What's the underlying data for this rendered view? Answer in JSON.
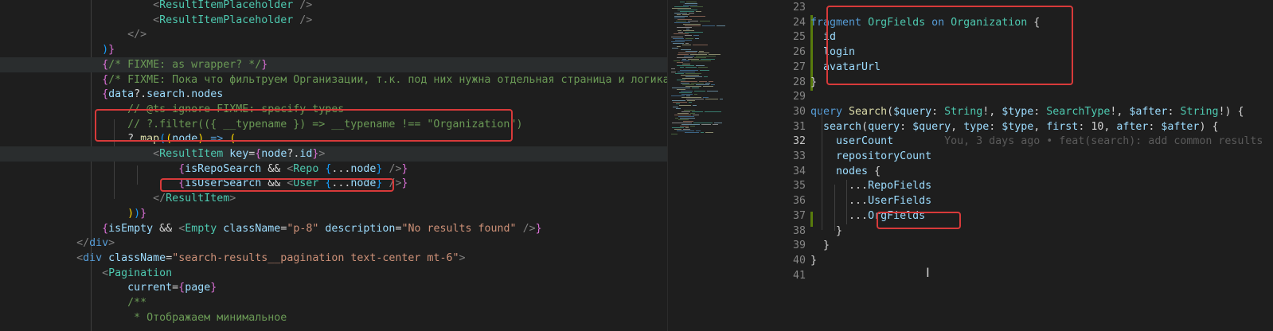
{
  "left_editor": {
    "lines": [
      [
        [
          "",
          "pun",
          "                        "
        ],
        [
          "<",
          "tag"
        ],
        [
          "ResultItemPlaceholder",
          "ty"
        ],
        [
          " />",
          "tag"
        ]
      ],
      [
        [
          "",
          "pun",
          "                        "
        ],
        [
          "<",
          "tag"
        ],
        [
          "ResultItemPlaceholder",
          "ty"
        ],
        [
          " />",
          "tag"
        ]
      ],
      [
        [
          "",
          "pun",
          "                    "
        ],
        [
          "</>",
          "tag"
        ]
      ],
      [
        [
          "",
          "pun",
          "                "
        ],
        [
          ")",
          "br3"
        ],
        [
          "}",
          "br2"
        ]
      ],
      [
        [
          "",
          "pun",
          "                "
        ],
        [
          "{",
          "br2"
        ],
        [
          "/* FIXME: as wrapper? */",
          "cm"
        ],
        [
          "}",
          "br2"
        ]
      ],
      [
        [
          "",
          "pun",
          "                "
        ],
        [
          "{",
          "br2"
        ],
        [
          "/* FIXME: Пока что фильтруем Организации, т.к. под них нужна отдельная страница и логика */",
          "cm"
        ],
        [
          "}",
          "br2"
        ]
      ],
      [
        [
          "",
          "pun",
          "                "
        ],
        [
          "{",
          "br2"
        ],
        [
          "data",
          "var"
        ],
        [
          "?.",
          "pun"
        ],
        [
          "search",
          "var"
        ],
        [
          ".",
          "pun"
        ],
        [
          "nodes",
          "var"
        ]
      ],
      [
        [
          "",
          "pun",
          "                    "
        ],
        [
          "// @ts-ignore FIXME: specify types",
          "cm"
        ]
      ],
      [
        [
          "",
          "pun",
          "                    "
        ],
        [
          "// ?.filter(({ __typename }) => __typename !== \"Organization\")",
          "cm"
        ]
      ],
      [
        [
          "",
          "pun",
          "                    "
        ],
        [
          "?.",
          "pun"
        ],
        [
          "map",
          "fn"
        ],
        [
          "(",
          "br3"
        ],
        [
          "(",
          "br1"
        ],
        [
          "node",
          "var"
        ],
        [
          ")",
          "br1"
        ],
        [
          " => ",
          "kw"
        ],
        [
          "(",
          "br1"
        ]
      ],
      [
        [
          "",
          "pun",
          "                        "
        ],
        [
          "<",
          "tag"
        ],
        [
          "ResultItem",
          "ty"
        ],
        [
          " ",
          "pun"
        ],
        [
          "key",
          "var"
        ],
        [
          "=",
          "pun"
        ],
        [
          "{",
          "br2"
        ],
        [
          "node",
          "var"
        ],
        [
          "?.",
          "pun"
        ],
        [
          "id",
          "var"
        ],
        [
          "}",
          "br2"
        ],
        [
          ">",
          "tag"
        ]
      ],
      [
        [
          "",
          "pun",
          "                            "
        ],
        [
          "{",
          "br2"
        ],
        [
          "isRepoSearch",
          "var"
        ],
        [
          " && ",
          "pun"
        ],
        [
          "<",
          "tag"
        ],
        [
          "Repo",
          "ty"
        ],
        [
          " ",
          "pun"
        ],
        [
          "{",
          "br3"
        ],
        [
          "...",
          "pun"
        ],
        [
          "node",
          "var"
        ],
        [
          "}",
          "br3"
        ],
        [
          " />",
          "tag"
        ],
        [
          "}",
          "br2"
        ]
      ],
      [
        [
          "",
          "pun",
          "                            "
        ],
        [
          "{",
          "br2"
        ],
        [
          "isUserSearch",
          "var"
        ],
        [
          " && ",
          "pun"
        ],
        [
          "<",
          "tag"
        ],
        [
          "User",
          "ty"
        ],
        [
          " ",
          "pun"
        ],
        [
          "{",
          "br3"
        ],
        [
          "...",
          "pun"
        ],
        [
          "node",
          "var"
        ],
        [
          "}",
          "br3"
        ],
        [
          " />",
          "tag"
        ],
        [
          "}",
          "br2"
        ]
      ],
      [
        [
          "",
          "pun",
          "                        "
        ],
        [
          "</",
          "tag"
        ],
        [
          "ResultItem",
          "ty"
        ],
        [
          ">",
          "tag"
        ]
      ],
      [
        [
          "",
          "pun",
          "                    "
        ],
        [
          ")",
          "br1"
        ],
        [
          ")",
          "br3"
        ],
        [
          "}",
          "br2"
        ]
      ],
      [
        [
          "",
          "pun",
          "                "
        ],
        [
          "{",
          "br2"
        ],
        [
          "isEmpty",
          "var"
        ],
        [
          " && ",
          "pun"
        ],
        [
          "<",
          "tag"
        ],
        [
          "Empty",
          "ty"
        ],
        [
          " ",
          "pun"
        ],
        [
          "className",
          "var"
        ],
        [
          "=",
          "pun"
        ],
        [
          "\"p-8\"",
          "str"
        ],
        [
          " ",
          "pun"
        ],
        [
          "description",
          "var"
        ],
        [
          "=",
          "pun"
        ],
        [
          "\"No results found\"",
          "str"
        ],
        [
          " />",
          "tag"
        ],
        [
          "}",
          "br2"
        ]
      ],
      [
        [
          "",
          "pun",
          "            "
        ],
        [
          "</",
          "tag"
        ],
        [
          "div",
          "kw"
        ],
        [
          ">",
          "tag"
        ]
      ],
      [
        [
          "",
          "pun",
          "            "
        ],
        [
          "<",
          "tag"
        ],
        [
          "div",
          "kw"
        ],
        [
          " ",
          "pun"
        ],
        [
          "className",
          "var"
        ],
        [
          "=",
          "pun"
        ],
        [
          "\"search-results__pagination text-center mt-6\"",
          "str"
        ],
        [
          ">",
          "tag"
        ]
      ],
      [
        [
          "",
          "pun",
          "                "
        ],
        [
          "<",
          "tag"
        ],
        [
          "Pagination",
          "ty"
        ]
      ],
      [
        [
          "",
          "pun",
          "                    "
        ],
        [
          "current",
          "var"
        ],
        [
          "=",
          "pun"
        ],
        [
          "{",
          "br2"
        ],
        [
          "page",
          "var"
        ],
        [
          "}",
          "br2"
        ]
      ],
      [
        [
          "",
          "pun",
          "                    "
        ],
        [
          "/**",
          "cm"
        ]
      ],
      [
        [
          "",
          "pun",
          "                     "
        ],
        [
          "* Отображаем минимальное",
          "cm"
        ]
      ]
    ]
  },
  "right_editor": {
    "line_numbers": [
      "23",
      "24",
      "25",
      "26",
      "27",
      "28",
      "29",
      "30",
      "31",
      "32",
      "33",
      "34",
      "35",
      "36",
      "37",
      "38",
      "39",
      "40",
      "41"
    ],
    "lines": [
      [],
      [
        [
          "fragment",
          "kw"
        ],
        [
          " ",
          "pun"
        ],
        [
          "OrgFields",
          "ty"
        ],
        [
          " on ",
          "kw"
        ],
        [
          "Organization",
          "ty"
        ],
        [
          " {",
          "pun"
        ]
      ],
      [
        [
          "  ",
          "pun"
        ],
        [
          "id",
          "var"
        ]
      ],
      [
        [
          "  ",
          "pun"
        ],
        [
          "login",
          "var"
        ]
      ],
      [
        [
          "  ",
          "pun"
        ],
        [
          "avatarUrl",
          "var"
        ]
      ],
      [
        [
          "}",
          "pun"
        ]
      ],
      [],
      [
        [
          "query",
          "kw"
        ],
        [
          " ",
          "pun"
        ],
        [
          "Search",
          "fn"
        ],
        [
          "(",
          "pun"
        ],
        [
          "$query",
          "var"
        ],
        [
          ": ",
          "pun"
        ],
        [
          "String",
          "ty"
        ],
        [
          "!, ",
          "pun"
        ],
        [
          "$type",
          "var"
        ],
        [
          ": ",
          "pun"
        ],
        [
          "SearchType",
          "ty"
        ],
        [
          "!, ",
          "pun"
        ],
        [
          "$after",
          "var"
        ],
        [
          ": ",
          "pun"
        ],
        [
          "String",
          "ty"
        ],
        [
          "!) {",
          "pun"
        ]
      ],
      [
        [
          "  ",
          "pun"
        ],
        [
          "search",
          "var"
        ],
        [
          "(",
          "pun"
        ],
        [
          "query",
          "var"
        ],
        [
          ": ",
          "pun"
        ],
        [
          "$query",
          "var"
        ],
        [
          ", ",
          "pun"
        ],
        [
          "type",
          "var"
        ],
        [
          ": ",
          "pun"
        ],
        [
          "$type",
          "var"
        ],
        [
          ", ",
          "pun"
        ],
        [
          "first",
          "var"
        ],
        [
          ": ",
          "pun"
        ],
        [
          "10",
          "pun"
        ],
        [
          ", ",
          "pun"
        ],
        [
          "after",
          "var"
        ],
        [
          ": ",
          "pun"
        ],
        [
          "$after",
          "var"
        ],
        [
          ") {",
          "pun"
        ]
      ],
      [
        [
          "    ",
          "pun"
        ],
        [
          "userCount",
          "var"
        ],
        [
          "        You, 3 days ago • feat(search): add common results",
          "ghost"
        ]
      ],
      [
        [
          "    ",
          "pun"
        ],
        [
          "repositoryCount",
          "var"
        ]
      ],
      [
        [
          "    ",
          "pun"
        ],
        [
          "nodes",
          "var"
        ],
        [
          " {",
          "pun"
        ]
      ],
      [
        [
          "      ",
          "pun"
        ],
        [
          "...",
          "pun"
        ],
        [
          "RepoFields",
          "var"
        ]
      ],
      [
        [
          "      ",
          "pun"
        ],
        [
          "...",
          "pun"
        ],
        [
          "UserFields",
          "var"
        ]
      ],
      [
        [
          "      ",
          "pun"
        ],
        [
          "...",
          "pun"
        ],
        [
          "OrgFields",
          "var"
        ]
      ],
      [
        [
          "    ",
          "pun"
        ],
        [
          "}",
          "pun"
        ]
      ],
      [
        [
          "  ",
          "pun"
        ],
        [
          "}",
          "pun"
        ]
      ],
      [
        [
          "}",
          "pun"
        ]
      ],
      []
    ]
  },
  "colors": {
    "background": "#1e1e1e",
    "highlight_box": "#d83a3a",
    "git_added": "#587c0c"
  }
}
